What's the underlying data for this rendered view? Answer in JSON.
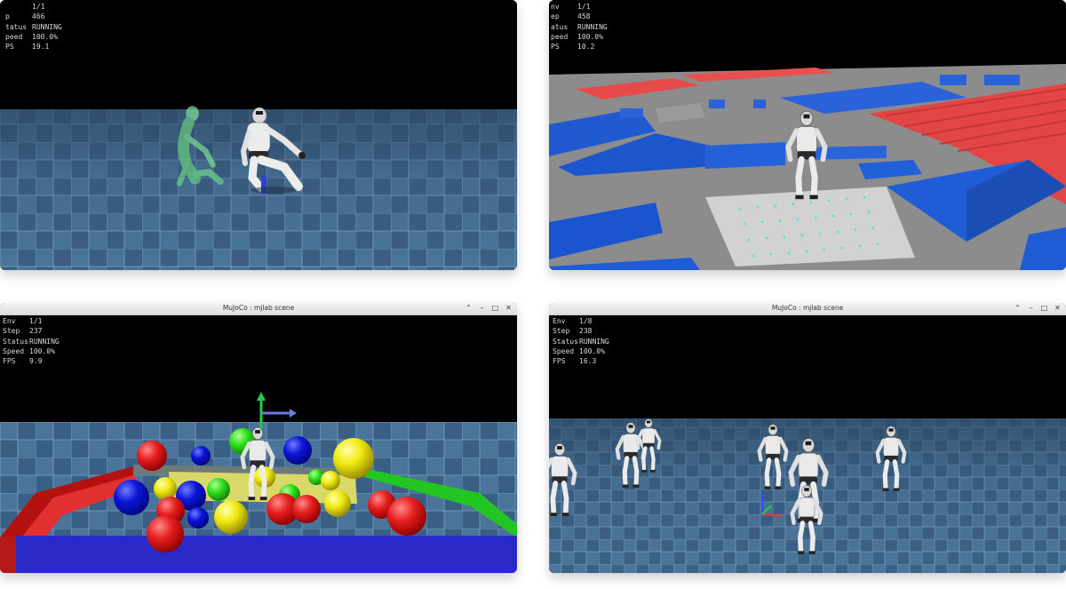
{
  "window": {
    "title": "MuJoCo : mjlab scene"
  },
  "window_controls": {
    "collapse": "⌃",
    "minimize": "–",
    "maximize": "□",
    "close": "✕"
  },
  "hud_labels": {
    "env": "Env",
    "step": "Step",
    "status": "Status",
    "speed": "Speed",
    "fps": "FPS"
  },
  "hud_labels_cropped": {
    "env": "",
    "step": "p",
    "status": "tatus",
    "speed": "peed",
    "fps": "PS"
  },
  "hud_labels_cropped_tr": {
    "env": "nv",
    "step": "ep",
    "status": "atus",
    "speed": "peed",
    "fps": "PS"
  },
  "panels": {
    "tracking": {
      "env": "1/1",
      "step": "466",
      "status": "RUNNING",
      "speed": "100.0%",
      "fps": "19.1"
    },
    "terrain": {
      "env": "1/1",
      "step": "458",
      "status": "RUNNING",
      "speed": "100.0%",
      "fps": "10.2"
    },
    "balls": {
      "env": "1/1",
      "step": "237",
      "status": "RUNNING",
      "speed": "100.0%",
      "fps": "9.9"
    },
    "multi": {
      "env": "1/8",
      "step": "238",
      "status": "RUNNING",
      "speed": "100.0%",
      "fps": "16.3"
    }
  },
  "colors": {
    "sky": "#000000",
    "floor_blue": "#3d6488",
    "terrain_gray": "#8a8a8a",
    "box_blue": "#1f5fd6",
    "box_red": "#e54848",
    "robot_white": "#e8e8e8",
    "ghost_green": "#6fd08c"
  }
}
